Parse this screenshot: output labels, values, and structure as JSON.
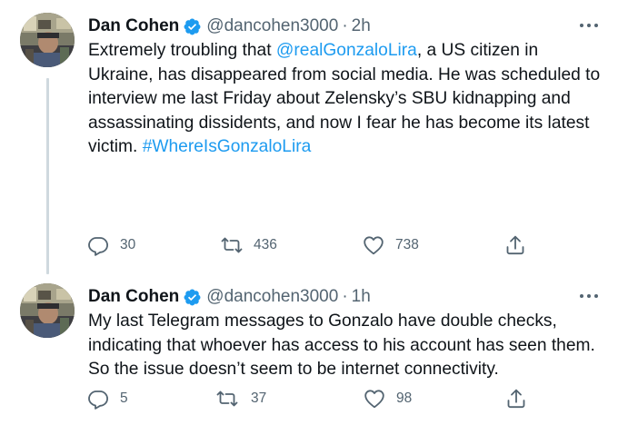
{
  "colors": {
    "link": "#1d9bf0",
    "verified": "#1d9bf0",
    "secondary_text": "#536471",
    "thread_line": "#cfd9de"
  },
  "tweets": [
    {
      "display_name": "Dan Cohen",
      "verified_icon": "verified-badge-icon",
      "handle": "@dancohen3000",
      "separator": "·",
      "time": "2h",
      "text": {
        "part1": "Extremely troubling that ",
        "mention": "@realGonzaloLira",
        "part2": ", a US citizen in Ukraine, has disappeared from social media. He was scheduled to interview me last Friday about Zelensky’s SBU kidnapping and assassinating dissidents, and now I fear he has become its latest victim. ",
        "hashtag": "#WhereIsGonzaloLira"
      },
      "actions": {
        "reply_count": "30",
        "retweet_count": "436",
        "like_count": "738"
      }
    },
    {
      "display_name": "Dan Cohen",
      "verified_icon": "verified-badge-icon",
      "handle": "@dancohen3000",
      "separator": "·",
      "time": "1h",
      "text": {
        "full": "My last Telegram messages to Gonzalo  have double checks, indicating that whoever has access to his account has seen them. So the issue doesn’t seem to be internet connectivity."
      },
      "actions": {
        "reply_count": "5",
        "retweet_count": "37",
        "like_count": "98"
      }
    }
  ]
}
